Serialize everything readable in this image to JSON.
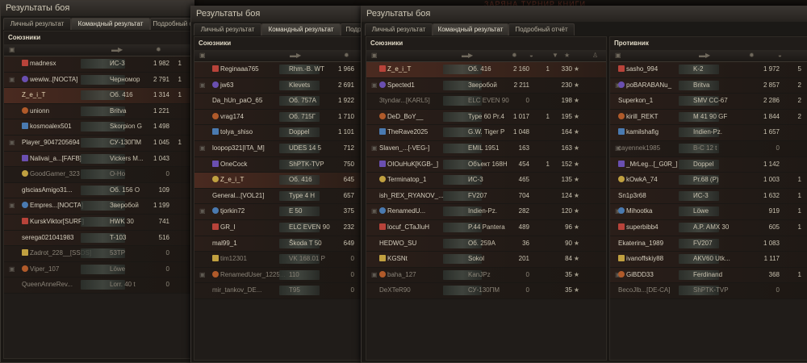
{
  "background_banner": "ЗАРЯНА ТУРНИР КНИГИ",
  "windows": [
    {
      "title": "Результаты боя",
      "tabs": [
        "Личный результат",
        "Командный результат",
        "Подробный отчёт"
      ],
      "active_tab": 1,
      "panel_title": "Союзники",
      "rows": [
        {
          "name": "madnesx",
          "tank": "ИС-3",
          "dmg": "1 982",
          "frags": "1"
        },
        {
          "name": "wewiw..[NOCTA]",
          "tank": "Черномор",
          "dmg": "2 791",
          "frags": "1"
        },
        {
          "name": "Z_e_i_T",
          "tank": "Об. 416",
          "dmg": "1 314",
          "frags": "1",
          "me": true
        },
        {
          "name": "unionn",
          "tank": "Britva",
          "dmg": "1 221",
          "frags": ""
        },
        {
          "name": "kosmoalex501",
          "tank": "Skorpion G",
          "dmg": "1 498",
          "frags": ""
        },
        {
          "name": "Player_9047205694",
          "tank": "СУ-130ПМ",
          "dmg": "1 045",
          "frags": "1"
        },
        {
          "name": "Nalivai_a...[FAFB]",
          "tank": "Vickers M...",
          "dmg": "1 043",
          "frags": ""
        },
        {
          "name": "GoodGamer_323",
          "tank": "O-Ho",
          "dmg": "0",
          "frags": ""
        },
        {
          "name": "glsciasAmigo31...",
          "tank": "Об. 156 О",
          "dmg": "109",
          "frags": ""
        },
        {
          "name": "Empres...[NOCTA]",
          "tank": "Зверобой",
          "dmg": "1 199",
          "frags": ""
        },
        {
          "name": "KurskViktor[SURF]",
          "tank": "HWK 30",
          "dmg": "741",
          "frags": ""
        },
        {
          "name": "serega021041983",
          "tank": "T-103",
          "dmg": "516",
          "frags": ""
        },
        {
          "name": "Zadrot_228__[SSDS]",
          "tank": "53TP",
          "dmg": "0",
          "frags": ""
        },
        {
          "name": "Viper_107",
          "tank": "Löwe",
          "dmg": "0",
          "frags": ""
        },
        {
          "name": "QueenAnneRev...",
          "tank": "Lorr. 40 t",
          "dmg": "0",
          "frags": ""
        }
      ]
    },
    {
      "title": "Результаты боя",
      "tabs": [
        "Личный результат",
        "Командный результат",
        "Подр"
      ],
      "active_tab": 1,
      "panel_title": "Союзники",
      "rows": [
        {
          "name": "Reginaaa765",
          "tank": "Rhm.-B. WT",
          "dmg": "1 966"
        },
        {
          "name": "jw63",
          "tank": "Klevets",
          "dmg": "2 691"
        },
        {
          "name": "Da_hUn_paO_65",
          "tank": "Об. 757А",
          "dmg": "1 922"
        },
        {
          "name": "vrag174",
          "tank": "Об. 715Г",
          "dmg": "1 710"
        },
        {
          "name": "tolya_shiso",
          "tank": "Doppel",
          "dmg": "1 101"
        },
        {
          "name": "loopop321[ITA_M]",
          "tank": "UDES 14 5",
          "dmg": "712"
        },
        {
          "name": "OneCock",
          "tank": "ShPTK-TVP",
          "dmg": "750"
        },
        {
          "name": "Z_e_i_T",
          "tank": "Об. 416",
          "dmg": "645",
          "me": true
        },
        {
          "name": "General...[VOL21]",
          "tank": "Type 4 H",
          "dmg": "657"
        },
        {
          "name": "tjorkin72",
          "tank": "E 50",
          "dmg": "375"
        },
        {
          "name": "GR_I",
          "tank": "ELC EVEN 90",
          "dmg": "232"
        },
        {
          "name": "mal99_1",
          "tank": "Škoda T 50",
          "dmg": "649"
        },
        {
          "name": "tim12301",
          "tank": "VK 168.01 P",
          "dmg": "0"
        },
        {
          "name": "RenamedUser_1225...",
          "tank": "110",
          "dmg": "0"
        },
        {
          "name": "mir_tankov_DE...",
          "tank": "T95",
          "dmg": "0"
        }
      ]
    },
    {
      "title": "Результаты боя",
      "tabs": [
        "Личный результат",
        "Командный результат",
        "Подробный отчёт"
      ],
      "active_tab": 1,
      "allies_title": "Союзники",
      "enemies_title": "Противник",
      "allies": [
        {
          "name": "Z_e_i_T",
          "tank": "Об. 416",
          "dmg": "2 160",
          "frags": "1",
          "xp": "330",
          "me": true
        },
        {
          "name": "Spected1",
          "tank": "Зверобой",
          "dmg": "2 211",
          "frags": "",
          "xp": "230"
        },
        {
          "name": "3tyndar...[KARL5]",
          "tank": "ELC EVEN 90",
          "dmg": "0",
          "frags": "",
          "xp": "198"
        },
        {
          "name": "DeD_BoY__",
          "tank": "Type 60 Pr.4",
          "dmg": "1 017",
          "frags": "1",
          "xp": "195"
        },
        {
          "name": "TheRave2025",
          "tank": "G.W. Tiger P",
          "dmg": "1 048",
          "frags": "",
          "xp": "164"
        },
        {
          "name": "Slaven_...[-VEG-]",
          "tank": "EMIL 1951",
          "dmg": "163",
          "frags": "",
          "xp": "163"
        },
        {
          "name": "OIOuHuK[KGB-_]",
          "tank": "Объект 168Н",
          "dmg": "454",
          "frags": "1",
          "xp": "152"
        },
        {
          "name": "Terminatop_1",
          "tank": "ИС-3",
          "dmg": "465",
          "frags": "",
          "xp": "135"
        },
        {
          "name": "ish_REX_RYANOV_...",
          "tank": "FV207",
          "dmg": "704",
          "frags": "",
          "xp": "124"
        },
        {
          "name": "RenamedU...",
          "tank": "Indien-Pz.",
          "dmg": "282",
          "frags": "",
          "xp": "120"
        },
        {
          "name": "locuf_CTaJIuH",
          "tank": "P.44 Pantera",
          "dmg": "489",
          "frags": "",
          "xp": "96"
        },
        {
          "name": "HEDWO_SU",
          "tank": "Об. 259А",
          "dmg": "36",
          "frags": "",
          "xp": "90"
        },
        {
          "name": "KGSNt",
          "tank": "Sokol",
          "dmg": "201",
          "frags": "",
          "xp": "84"
        },
        {
          "name": "baha_127",
          "tank": "KanJPz",
          "dmg": "0",
          "frags": "",
          "xp": "35"
        },
        {
          "name": "DeXTeR90",
          "tank": "СУ-130ПМ",
          "dmg": "0",
          "frags": "",
          "xp": "35"
        }
      ],
      "enemies": [
        {
          "name": "sasho_994",
          "tank": "K-2",
          "dmg": "1 972",
          "frags": "5"
        },
        {
          "name": "poBARABANu_",
          "tank": "Britva",
          "dmg": "2 857",
          "frags": "2"
        },
        {
          "name": "Superkon_1",
          "tank": "SMV CC-67",
          "dmg": "2 286",
          "frags": "2"
        },
        {
          "name": "kirill_REKT",
          "tank": "M 41 90 GF",
          "dmg": "1 844",
          "frags": "2"
        },
        {
          "name": "kamilshafig",
          "tank": "Indien-Pz.",
          "dmg": "1 657",
          "frags": ""
        },
        {
          "name": "cayennek1985",
          "tank": "B-C 12 t",
          "dmg": "0",
          "frags": ""
        },
        {
          "name": "_MrLeg...[_G0R_]",
          "tank": "Doppel",
          "dmg": "1 142",
          "frags": ""
        },
        {
          "name": "kOwkA_74",
          "tank": "Pr.68 (P)",
          "dmg": "1 003",
          "frags": "1"
        },
        {
          "name": "Sn1p3r68",
          "tank": "ИС-3",
          "dmg": "1 632",
          "frags": "1"
        },
        {
          "name": "Mihootka",
          "tank": "Löwe",
          "dmg": "919",
          "frags": "1"
        },
        {
          "name": "superbibb4",
          "tank": "A.P. AMX 30",
          "dmg": "605",
          "frags": "1"
        },
        {
          "name": "Ekaterina_1989",
          "tank": "FV207",
          "dmg": "1 083",
          "frags": ""
        },
        {
          "name": "ivanoffskiy88",
          "tank": "AKV60 Utk...",
          "dmg": "1 117",
          "frags": ""
        },
        {
          "name": "GiBDD33",
          "tank": "Ferdinand",
          "dmg": "368",
          "frags": "1"
        },
        {
          "name": "BecoJlb...[DE-CA]",
          "tank": "ShPTK-TVP",
          "dmg": "0",
          "frags": ""
        }
      ]
    }
  ],
  "icons": {
    "star": "★",
    "platoon": "▣",
    "sort": "▼"
  },
  "colors": {
    "accent_row": "#4a2a20",
    "text_main": "#d6cfbe",
    "bg": "#14110e"
  }
}
